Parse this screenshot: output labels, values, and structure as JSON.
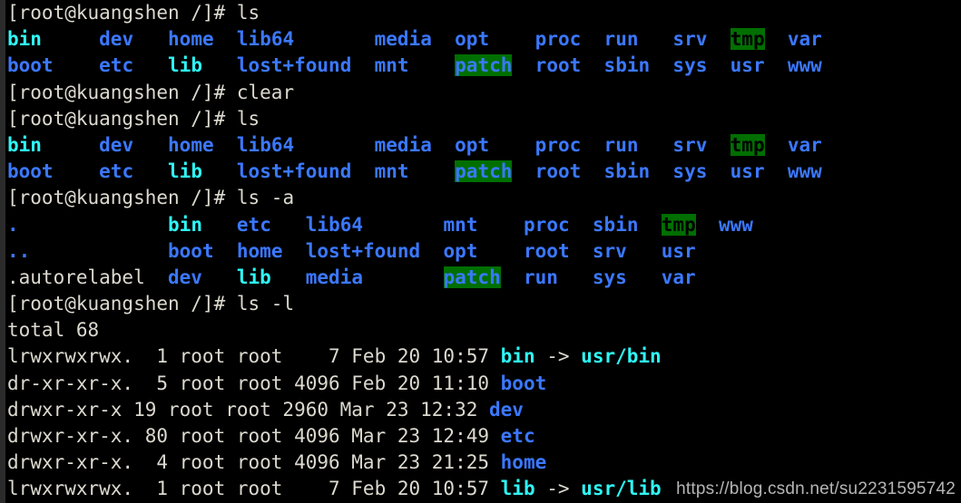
{
  "terminal": {
    "prompt": "[root@kuangshen /]# ",
    "watermark": "https://blog.csdn.net/su2231595742",
    "colors": {
      "background": "#000000",
      "foreground": "#dcd9cf",
      "directory": "#3b78ff",
      "symlink": "#2ff7f7",
      "other_writable_bg": "#006f00",
      "sticky_other_writable_fg": "#000000",
      "gutter": "#2b2b2b"
    },
    "lines": [
      {
        "id": "l1",
        "type": "command",
        "prompt": "[root@kuangshen /]# ",
        "command": "ls"
      },
      {
        "id": "l2",
        "type": "output",
        "text": "bin     dev   home  lib64       media  opt    proc  run   srv  tmp  var"
      },
      {
        "id": "l3",
        "type": "output",
        "text": "boot    etc   lib   lost+found  mnt    patch  root  sbin  sys  usr  www"
      },
      {
        "id": "l4",
        "type": "command",
        "prompt": "[root@kuangshen /]# ",
        "command": "clear"
      },
      {
        "id": "l5",
        "type": "command",
        "prompt": "[root@kuangshen /]# ",
        "command": "ls"
      },
      {
        "id": "l6",
        "type": "output",
        "text": "bin     dev   home  lib64       media  opt    proc  run   srv  tmp  var"
      },
      {
        "id": "l7",
        "type": "output",
        "text": "boot    etc   lib   lost+found  mnt    patch  root  sbin  sys  usr  www"
      },
      {
        "id": "l8",
        "type": "command",
        "prompt": "[root@kuangshen /]# ",
        "command": "ls -a"
      },
      {
        "id": "l9",
        "type": "output",
        "text": ".             bin   etc   lib64       mnt    proc  sbin  tmp  www"
      },
      {
        "id": "l10",
        "type": "output",
        "text": "..            boot  home  lost+found  opt    root  srv   usr"
      },
      {
        "id": "l11",
        "type": "output",
        "text": ".autorelabel  dev   lib   media       patch  run   sys   var"
      },
      {
        "id": "l12",
        "type": "command",
        "prompt": "[root@kuangshen /]# ",
        "command": "ls -l"
      },
      {
        "id": "l13",
        "type": "output",
        "text": "total 68"
      },
      {
        "id": "l14",
        "type": "longlist",
        "perms": "lrwxrwxrwx.",
        "links": " 1",
        "owner": "root",
        "group": "root",
        "size": "   7",
        "month": "Feb",
        "day": "20",
        "time": "10:57",
        "name": "bin",
        "target": "usr/bin"
      },
      {
        "id": "l15",
        "type": "longlist",
        "perms": "dr-xr-xr-x.",
        "links": " 5",
        "owner": "root",
        "group": "root",
        "size": "4096",
        "month": "Feb",
        "day": "20",
        "time": "11:10",
        "name": "boot",
        "target": ""
      },
      {
        "id": "l16",
        "type": "longlist",
        "perms": "drwxr-xr-x",
        "links": "19",
        "owner": "root",
        "group": "root",
        "size": "2960",
        "month": "Mar",
        "day": "23",
        "time": "12:32",
        "name": "dev",
        "target": ""
      },
      {
        "id": "l17",
        "type": "longlist",
        "perms": "drwxr-xr-x.",
        "links": "80",
        "owner": "root",
        "group": "root",
        "size": "4096",
        "month": "Mar",
        "day": "23",
        "time": "12:49",
        "name": "etc",
        "target": ""
      },
      {
        "id": "l18",
        "type": "longlist",
        "perms": "drwxr-xr-x.",
        "links": " 4",
        "owner": "root",
        "group": "root",
        "size": "4096",
        "month": "Mar",
        "day": "23",
        "time": "21:25",
        "name": "home",
        "target": ""
      },
      {
        "id": "l19",
        "type": "longlist",
        "perms": "lrwxrwxrwx.",
        "links": " 1",
        "owner": "root",
        "group": "root",
        "size": "   7",
        "month": "Feb",
        "day": "20",
        "time": "10:57",
        "name": "lib",
        "target": "usr/lib"
      }
    ],
    "file_types": {
      "symlinks": [
        "bin",
        "lib"
      ],
      "directories": [
        "boot",
        "dev",
        "etc",
        "home",
        "lib64",
        "lost+found",
        "media",
        "mnt",
        "opt",
        "proc",
        "root",
        "run",
        "sbin",
        "srv",
        "sys",
        "usr",
        "var",
        "www",
        ".",
        ".."
      ],
      "other_writable": [
        "patch"
      ],
      "sticky_other_writable": [
        "tmp"
      ],
      "regular_files": [
        ".autorelabel"
      ]
    }
  }
}
